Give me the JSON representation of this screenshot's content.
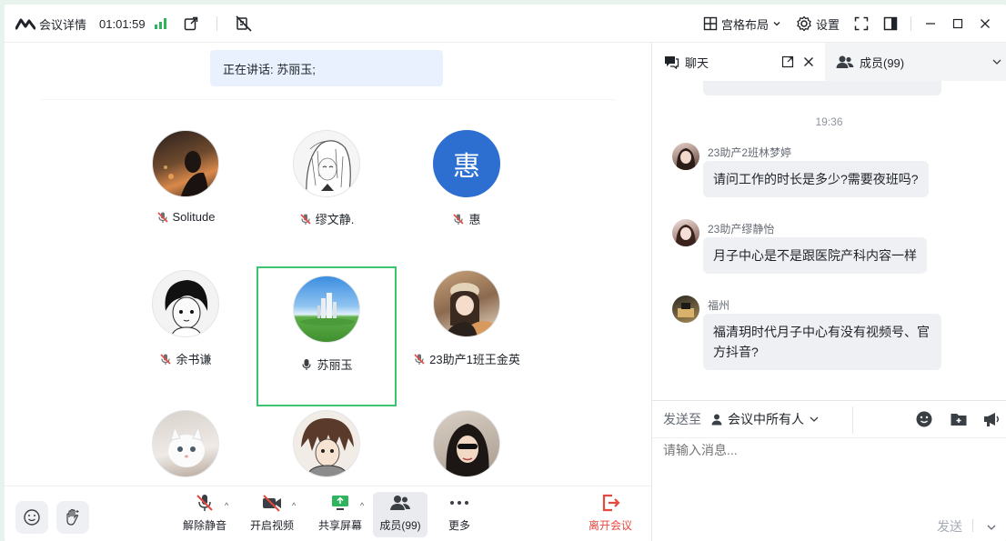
{
  "titlebar": {
    "meeting_details": "会议详情",
    "timer": "01:01:59",
    "layout_label": "宫格布局",
    "settings_label": "设置"
  },
  "speaking": {
    "text": "正在讲话: 苏丽玉;"
  },
  "participants": [
    {
      "name": "Solitude",
      "muted": true
    },
    {
      "name": "缪文静.",
      "muted": true
    },
    {
      "name": "惠",
      "muted": true,
      "avatar_text": "惠"
    },
    {
      "name": "余书谦",
      "muted": true
    },
    {
      "name": "苏丽玉",
      "muted": false,
      "speaking": true
    },
    {
      "name": "23助产1班王金英",
      "muted": true
    },
    {
      "name": "",
      "muted": true
    },
    {
      "name": "",
      "muted": true
    },
    {
      "name": "",
      "muted": true
    }
  ],
  "toolbar": {
    "unmute": "解除静音",
    "start_video": "开启视频",
    "share_screen": "共享屏幕",
    "members": "成员(99)",
    "more": "更多",
    "leave": "离开会议"
  },
  "right_panel": {
    "chat_tab": "聊天",
    "members_tab": "成员(99)",
    "messages": [
      {
        "time": "19:36"
      },
      {
        "sender": "23助产2班林梦婷",
        "text": "请问工作的时长是多少?需要夜班吗?"
      },
      {
        "sender": "23助产缪静怡",
        "text": "月子中心是不是跟医院产科内容一样"
      },
      {
        "sender": "福州",
        "text": "福清玥时代月子中心有没有视频号、官方抖音?"
      }
    ],
    "send_to_label": "发送至",
    "send_to_target": "会议中所有人",
    "input_placeholder": "请输入消息...",
    "send_button": "发送"
  },
  "colors": {
    "accent_green": "#3cc36d",
    "avatar_blue": "#2d6fd1",
    "leave_red": "#e5483f",
    "mute_red": "#e5483f"
  }
}
